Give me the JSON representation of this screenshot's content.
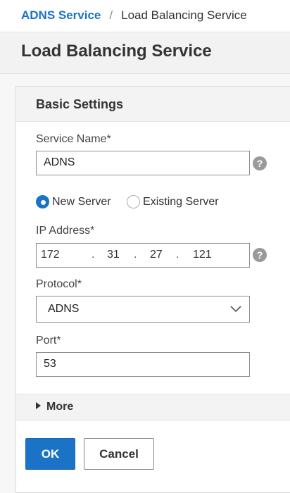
{
  "breadcrumb": {
    "parent": "ADNS Service",
    "separator": "/",
    "current": "Load Balancing Service"
  },
  "page": {
    "title": "Load Balancing Service"
  },
  "panel": {
    "title": "Basic Settings",
    "service_name": {
      "label": "Service Name*",
      "value": "ADNS"
    },
    "server_type": {
      "options": [
        {
          "label": "New Server",
          "selected": true
        },
        {
          "label": "Existing Server",
          "selected": false
        }
      ]
    },
    "ip_address": {
      "label": "IP Address*",
      "octets": [
        "172",
        "31",
        "27",
        "121"
      ],
      "separator": "."
    },
    "protocol": {
      "label": "Protocol*",
      "value": "ADNS"
    },
    "port": {
      "label": "Port*",
      "value": "53"
    },
    "more_label": "More",
    "help_icon": "question-mark-icon"
  },
  "buttons": {
    "ok_label": "OK",
    "cancel_label": "Cancel"
  },
  "colors": {
    "accent": "#1a73c7",
    "help_icon": "#9a9a9a"
  }
}
